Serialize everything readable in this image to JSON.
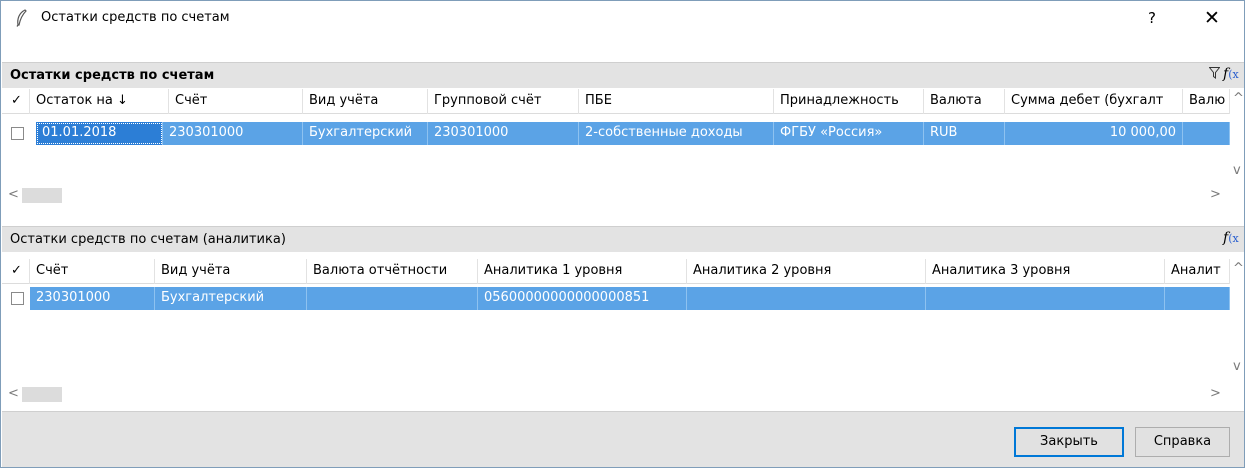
{
  "window": {
    "title": "Остатки средств по счетам",
    "help_label": "?",
    "close_label": "✕"
  },
  "top_panel": {
    "title": "Остатки средств по счетам",
    "filter_icon": "funnel-icon",
    "fx_label": "f",
    "fx_sub": "(x",
    "check_header": "✓",
    "columns": [
      "Остаток на ↓",
      "Счёт",
      "Вид учёта",
      "Групповой счёт",
      "ПБЕ",
      "Принадлежность",
      "Валюта",
      "Сумма дебет (бухгалт",
      "Валю"
    ],
    "rows": [
      [
        "01.01.2018",
        "230301000",
        "Бухгалтерский",
        "230301000",
        "2-собственные доходы",
        "ФГБУ «Россия»",
        "RUB",
        "10 000,00",
        ""
      ]
    ]
  },
  "bottom_panel": {
    "title": "Остатки средств по счетам (аналитика)",
    "fx_label": "f",
    "fx_sub": "(x",
    "check_header": "✓",
    "columns": [
      "Счёт",
      "Вид учёта",
      "Валюта отчётности",
      "Аналитика 1 уровня",
      "Аналитика 2 уровня",
      "Аналитика 3 уровня",
      "Аналит"
    ],
    "rows": [
      [
        "230301000",
        "Бухгалтерский",
        "",
        "05600000000000000851",
        "",
        "",
        ""
      ]
    ]
  },
  "scroll": {
    "left_arrow": "<",
    "right_arrow": ">",
    "up_arrow": "^",
    "down_arrow": "v"
  },
  "footer": {
    "close_button": "Закрыть",
    "help_button": "Справка"
  },
  "colors": {
    "selection": "#5ba3e6",
    "panel_bg": "#e3e3e3",
    "accent": "#0078d7"
  }
}
